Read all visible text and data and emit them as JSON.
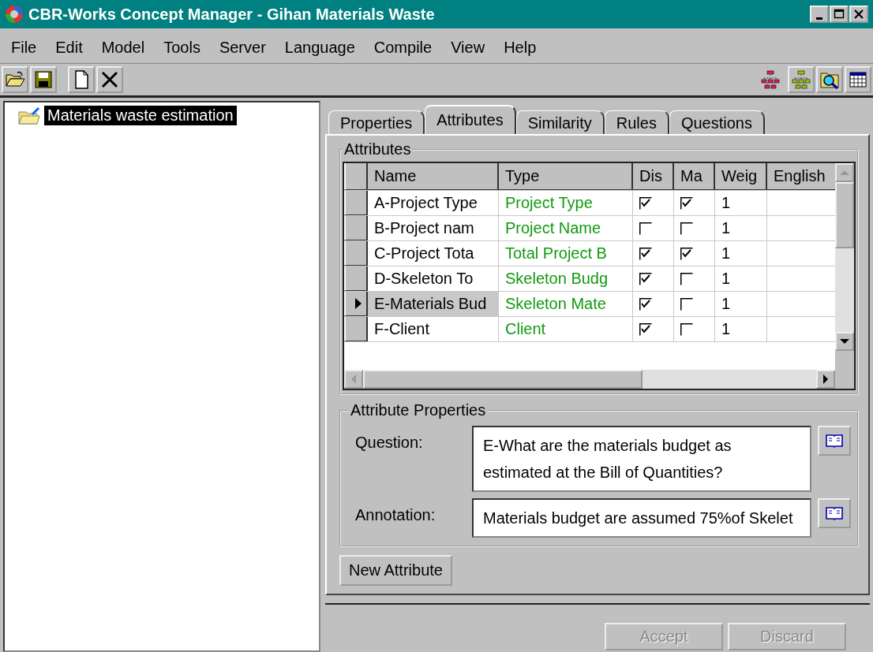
{
  "window": {
    "title": "CBR-Works Concept Manager - Gihan Materials Waste"
  },
  "menu": [
    "File",
    "Edit",
    "Model",
    "Tools",
    "Server",
    "Language",
    "Compile",
    "View",
    "Help"
  ],
  "tree": [
    {
      "label": "Materials waste estimation",
      "selected": true
    }
  ],
  "tabs": [
    {
      "label": "Properties",
      "selected": false
    },
    {
      "label": "Attributes",
      "selected": true
    },
    {
      "label": "Similarity",
      "selected": false
    },
    {
      "label": "Rules",
      "selected": false
    },
    {
      "label": "Questions",
      "selected": false
    }
  ],
  "attributes": {
    "title": "Attributes",
    "columns": [
      "Name",
      "Type",
      "Dis",
      "Ma",
      "Weig",
      "English"
    ],
    "rows": [
      {
        "name": "A-Project Type",
        "type": "Project Type",
        "dis": true,
        "ma": true,
        "weight": "1",
        "selected": false
      },
      {
        "name": "B-Project nam",
        "type": "Project Name",
        "dis": false,
        "ma": false,
        "weight": "1",
        "selected": false
      },
      {
        "name": "C-Project Tota",
        "type": "Total Project B",
        "dis": true,
        "ma": true,
        "weight": "1",
        "selected": false
      },
      {
        "name": "D-Skeleton To",
        "type": "Skeleton Budg",
        "dis": true,
        "ma": false,
        "weight": "1",
        "selected": false
      },
      {
        "name": "E-Materials Bud",
        "type": "Skeleton Mate",
        "dis": true,
        "ma": false,
        "weight": "1",
        "selected": true
      },
      {
        "name": "F-Client",
        "type": "Client",
        "dis": true,
        "ma": false,
        "weight": "1",
        "selected": false
      }
    ]
  },
  "attribute_properties": {
    "title": "Attribute Properties",
    "question": {
      "label": "Question:",
      "value": "E-What are the materials budget as estimated at the Bill of Quantities?"
    },
    "annotation": {
      "label": "Annotation:",
      "value": "Materials budget are assumed 75%of Skelet"
    }
  },
  "buttons": [
    {
      "label": "New Attribute",
      "disabled": false
    }
  ],
  "footer_buttons": [
    {
      "label": "Accept",
      "disabled": true
    },
    {
      "label": "Discard",
      "disabled": true
    }
  ]
}
